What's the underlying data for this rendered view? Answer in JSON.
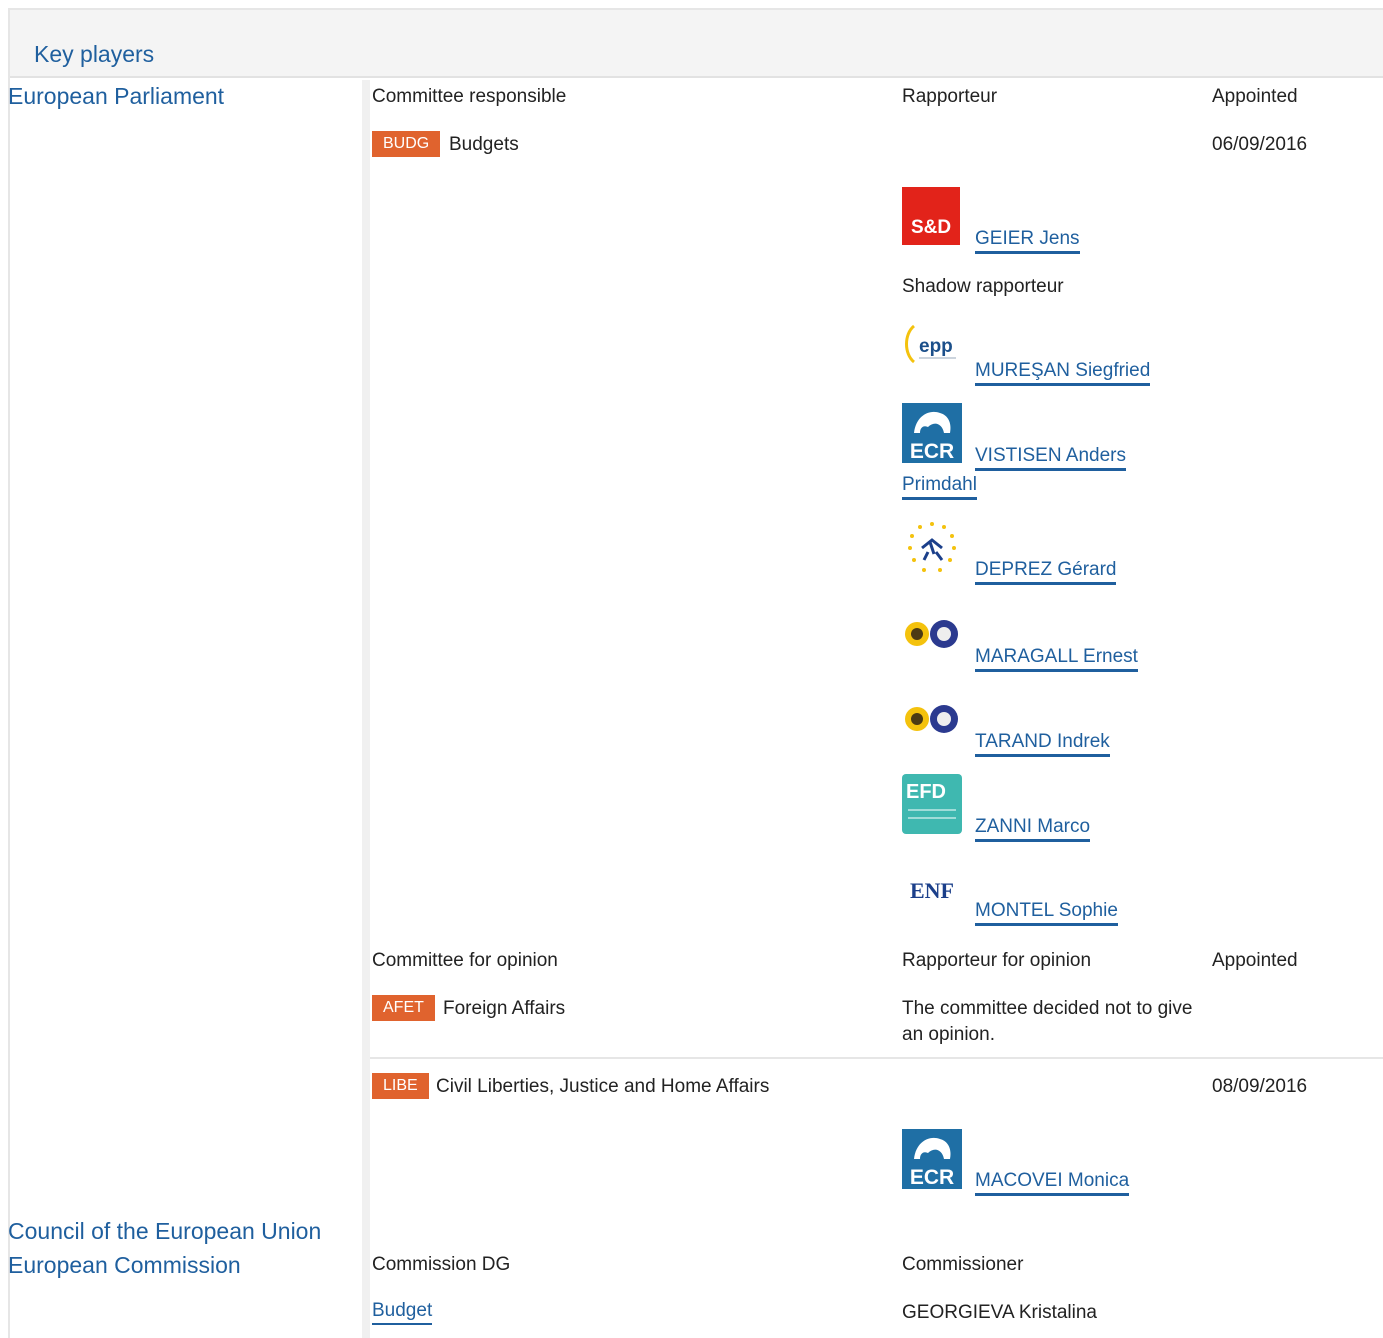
{
  "header": {
    "title": "Key players"
  },
  "institutions": {
    "parliament": "European Parliament",
    "council": "Council of the European Union",
    "commission": "European Commission"
  },
  "ep": {
    "col_committee": "Committee responsible",
    "col_rapporteur": "Rapporteur",
    "col_appointed": "Appointed",
    "responsible": {
      "tag": "BUDG",
      "name": "Budgets",
      "appointed": "06/09/2016"
    },
    "rapporteur": {
      "group_logo": "S&D",
      "name": "GEIER Jens"
    },
    "shadow_label": "Shadow rapporteur",
    "shadows": [
      {
        "group_logo": "epp",
        "name": "MUREŞAN Siegfried"
      },
      {
        "group_logo": "ECR",
        "name": "VISTISEN Anders Primdahl"
      },
      {
        "group_logo": "alde",
        "name": "DEPREZ Gérard"
      },
      {
        "group_logo": "greens",
        "name": "MARAGALL Ernest"
      },
      {
        "group_logo": "greens",
        "name": "TARAND Indrek"
      },
      {
        "group_logo": "EFD",
        "name": "ZANNI Marco"
      },
      {
        "group_logo": "ENF",
        "name": "MONTEL Sophie"
      }
    ],
    "col_opinion": "Committee for opinion",
    "col_rapporteur_opinion": "Rapporteur for opinion",
    "col_appointed2": "Appointed",
    "opinions": [
      {
        "tag": "AFET",
        "name": "Foreign Affairs",
        "note": "The committee decided not to give an opinion.",
        "appointed": ""
      },
      {
        "tag": "LIBE",
        "name": "Civil Liberties, Justice and Home Affairs",
        "appointed": "08/09/2016",
        "rapporteur": {
          "group_logo": "ECR",
          "name": "MACOVEI Monica"
        }
      }
    ]
  },
  "commission": {
    "col_dg": "Commission DG",
    "col_commissioner": "Commissioner",
    "dg": "Budget",
    "commissioner": "GEORGIEVA Kristalina"
  },
  "colors": {
    "link": "#1f5f9e",
    "tag": "#e0632e",
    "header_bg": "#f4f4f4"
  }
}
